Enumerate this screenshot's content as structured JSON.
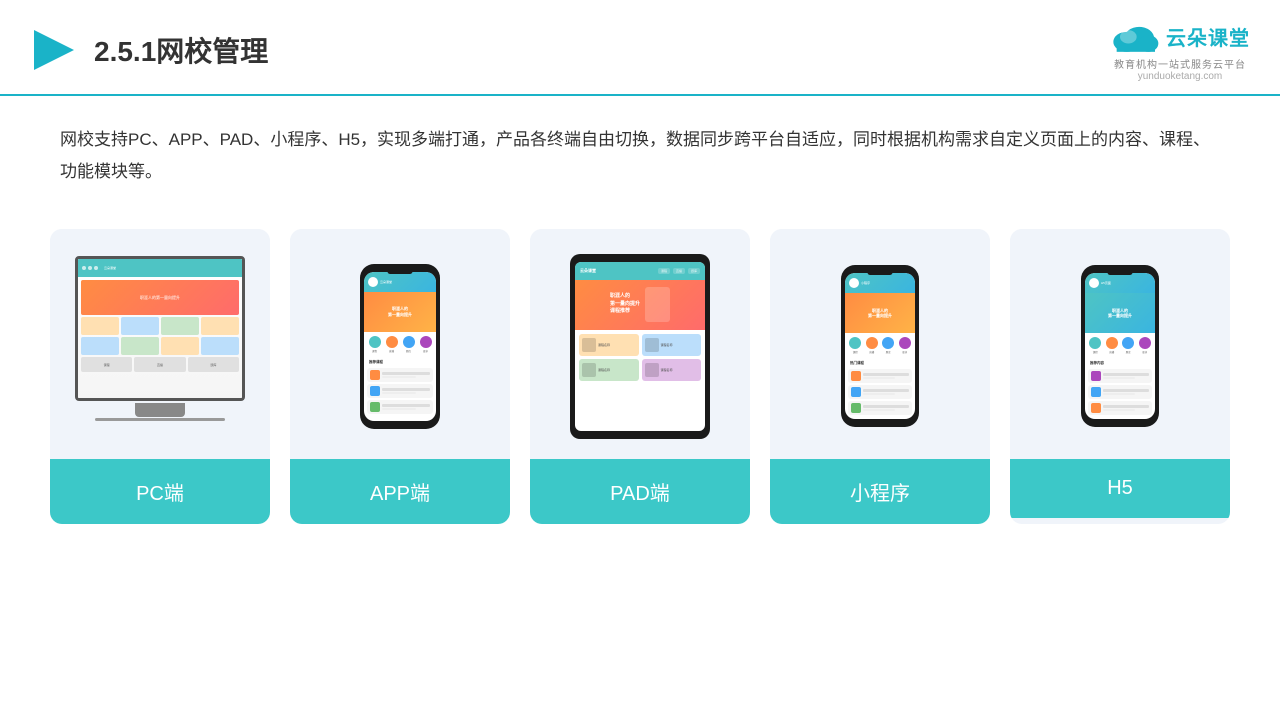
{
  "header": {
    "title": "2.5.1网校管理",
    "logo_name": "云朵课堂",
    "logo_url": "yunduoketang.com",
    "logo_tagline": "教育机构一站式服务云平台"
  },
  "description": {
    "text": "网校支持PC、APP、PAD、小程序、H5，实现多端打通，产品各终端自由切换，数据同步跨平台自适应，同时根据机构需求自定义页面上的内容、课程、功能模块等。"
  },
  "cards": [
    {
      "id": "pc",
      "label": "PC端"
    },
    {
      "id": "app",
      "label": "APP端"
    },
    {
      "id": "pad",
      "label": "PAD端"
    },
    {
      "id": "miniprogram",
      "label": "小程序"
    },
    {
      "id": "h5",
      "label": "H5"
    }
  ],
  "colors": {
    "accent": "#3cc8c8",
    "header_line": "#1ab3c8",
    "banner_orange": "#ff8c42",
    "bg_card": "#f0f4fa"
  }
}
